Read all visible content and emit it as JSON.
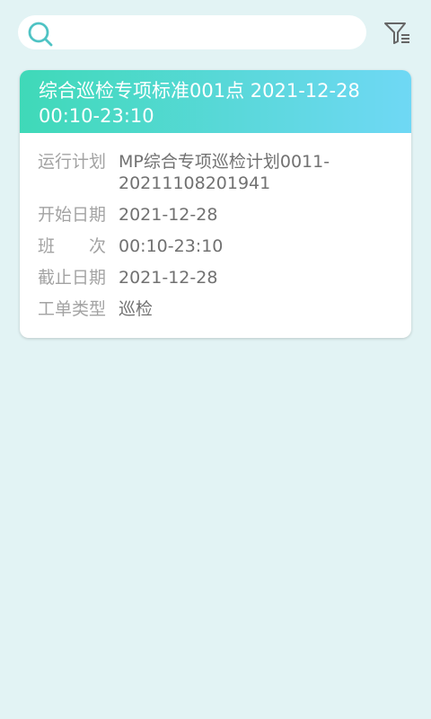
{
  "search": {
    "placeholder": ""
  },
  "card": {
    "title": "综合巡检专项标准001点 2021-12-28 00:10-23:10",
    "rows": [
      {
        "label": "运行计划",
        "value": "MP综合专项巡检计划0011-20211108201941"
      },
      {
        "label": "开始日期",
        "value": "2021-12-28"
      },
      {
        "label": "班　　次",
        "value": "00:10-23:10"
      },
      {
        "label": "截止日期",
        "value": "2021-12-28"
      },
      {
        "label": "工单类型",
        "value": "巡检"
      }
    ]
  },
  "colors": {
    "background": "#e2f3f4",
    "header_gradient_start": "#3fd9b8",
    "header_gradient_end": "#6fd8f5",
    "search_icon": "#4fc3c4",
    "filter_icon": "#666666"
  },
  "icons": {
    "search": "search-icon",
    "filter": "filter-icon"
  }
}
